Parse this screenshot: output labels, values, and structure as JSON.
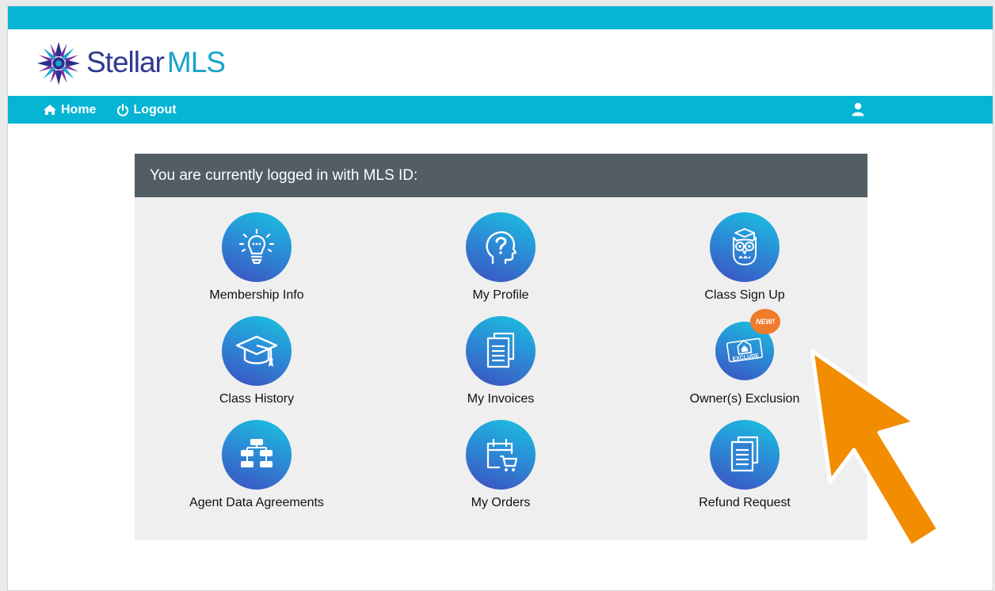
{
  "brand": {
    "name_main": "Stellar",
    "name_accent": "MLS"
  },
  "nav": {
    "home_label": "Home",
    "logout_label": "Logout"
  },
  "panel": {
    "header_text": "You are currently logged in with MLS ID:"
  },
  "tiles": [
    {
      "label": "Membership Info",
      "icon": "lightbulb-icon"
    },
    {
      "label": "My Profile",
      "icon": "head-question-icon"
    },
    {
      "label": "Class Sign Up",
      "icon": "owl-icon"
    },
    {
      "label": "Class History",
      "icon": "graduation-cap-icon"
    },
    {
      "label": "My Invoices",
      "icon": "documents-icon"
    },
    {
      "label": "Owner(s) Exclusion",
      "icon": "exclude-house-icon",
      "badge": "NEW!",
      "icon_text": "EXCLUDE"
    },
    {
      "label": "Agent Data Agreements",
      "icon": "org-chart-icon"
    },
    {
      "label": "My Orders",
      "icon": "calendar-cart-icon"
    },
    {
      "label": "Refund Request",
      "icon": "documents-icon"
    }
  ],
  "colors": {
    "bar_cyan": "#06b4d4",
    "header_gray": "#525d64",
    "panel_bg": "#efefef",
    "arrow_orange": "#f28c00",
    "badge_orange": "#f07b2a"
  }
}
